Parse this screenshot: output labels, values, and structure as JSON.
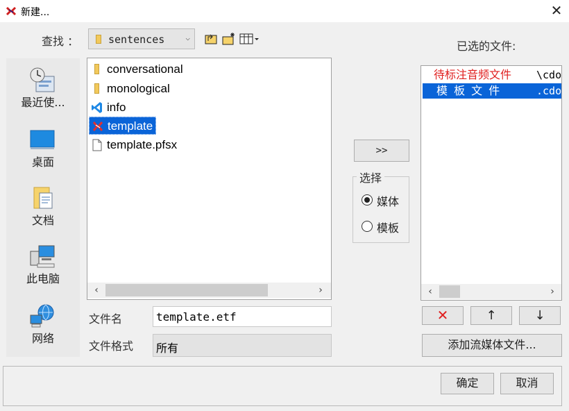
{
  "window": {
    "title": "新建...",
    "close_glyph": "✕",
    "accent": "#0a64d8"
  },
  "lookin": {
    "label": "查找 ：",
    "value": "sentences"
  },
  "places": [
    {
      "name": "recent",
      "label": "最近使..."
    },
    {
      "name": "desktop",
      "label": "桌面"
    },
    {
      "name": "documents",
      "label": "文档"
    },
    {
      "name": "this-pc",
      "label": "此电脑"
    },
    {
      "name": "network",
      "label": "网络"
    }
  ],
  "files": [
    {
      "name": "conversational",
      "icon": "folder-icon"
    },
    {
      "name": "monological",
      "icon": "folder-icon"
    },
    {
      "name": "info",
      "icon": "vscode-icon"
    },
    {
      "name": "template",
      "icon": "app-icon",
      "selected": true
    },
    {
      "name": "template.pfsx",
      "icon": "file-icon"
    }
  ],
  "filename": {
    "label": "文件名",
    "value": "template.etf"
  },
  "filetype": {
    "label": "文件格式",
    "value": "所有"
  },
  "add_button": ">>",
  "choice_group": {
    "title": "选择",
    "options": [
      {
        "label": "媒体",
        "checked": true
      },
      {
        "label": "模板",
        "checked": false
      }
    ]
  },
  "selected_files": {
    "label": "已选的文件:",
    "items": [
      {
        "tag": "待标注音频文件",
        "path": "\\cdo",
        "tag_color": "#e02020"
      },
      {
        "tag": "模 板 文 件",
        "path": ".cdo",
        "selected": true
      }
    ]
  },
  "list_buttons": {
    "remove": "✕",
    "up": "↑",
    "down": "↓"
  },
  "add_stream_button": "添加流媒体文件...",
  "ok_button": "确定",
  "cancel_button": "取消"
}
